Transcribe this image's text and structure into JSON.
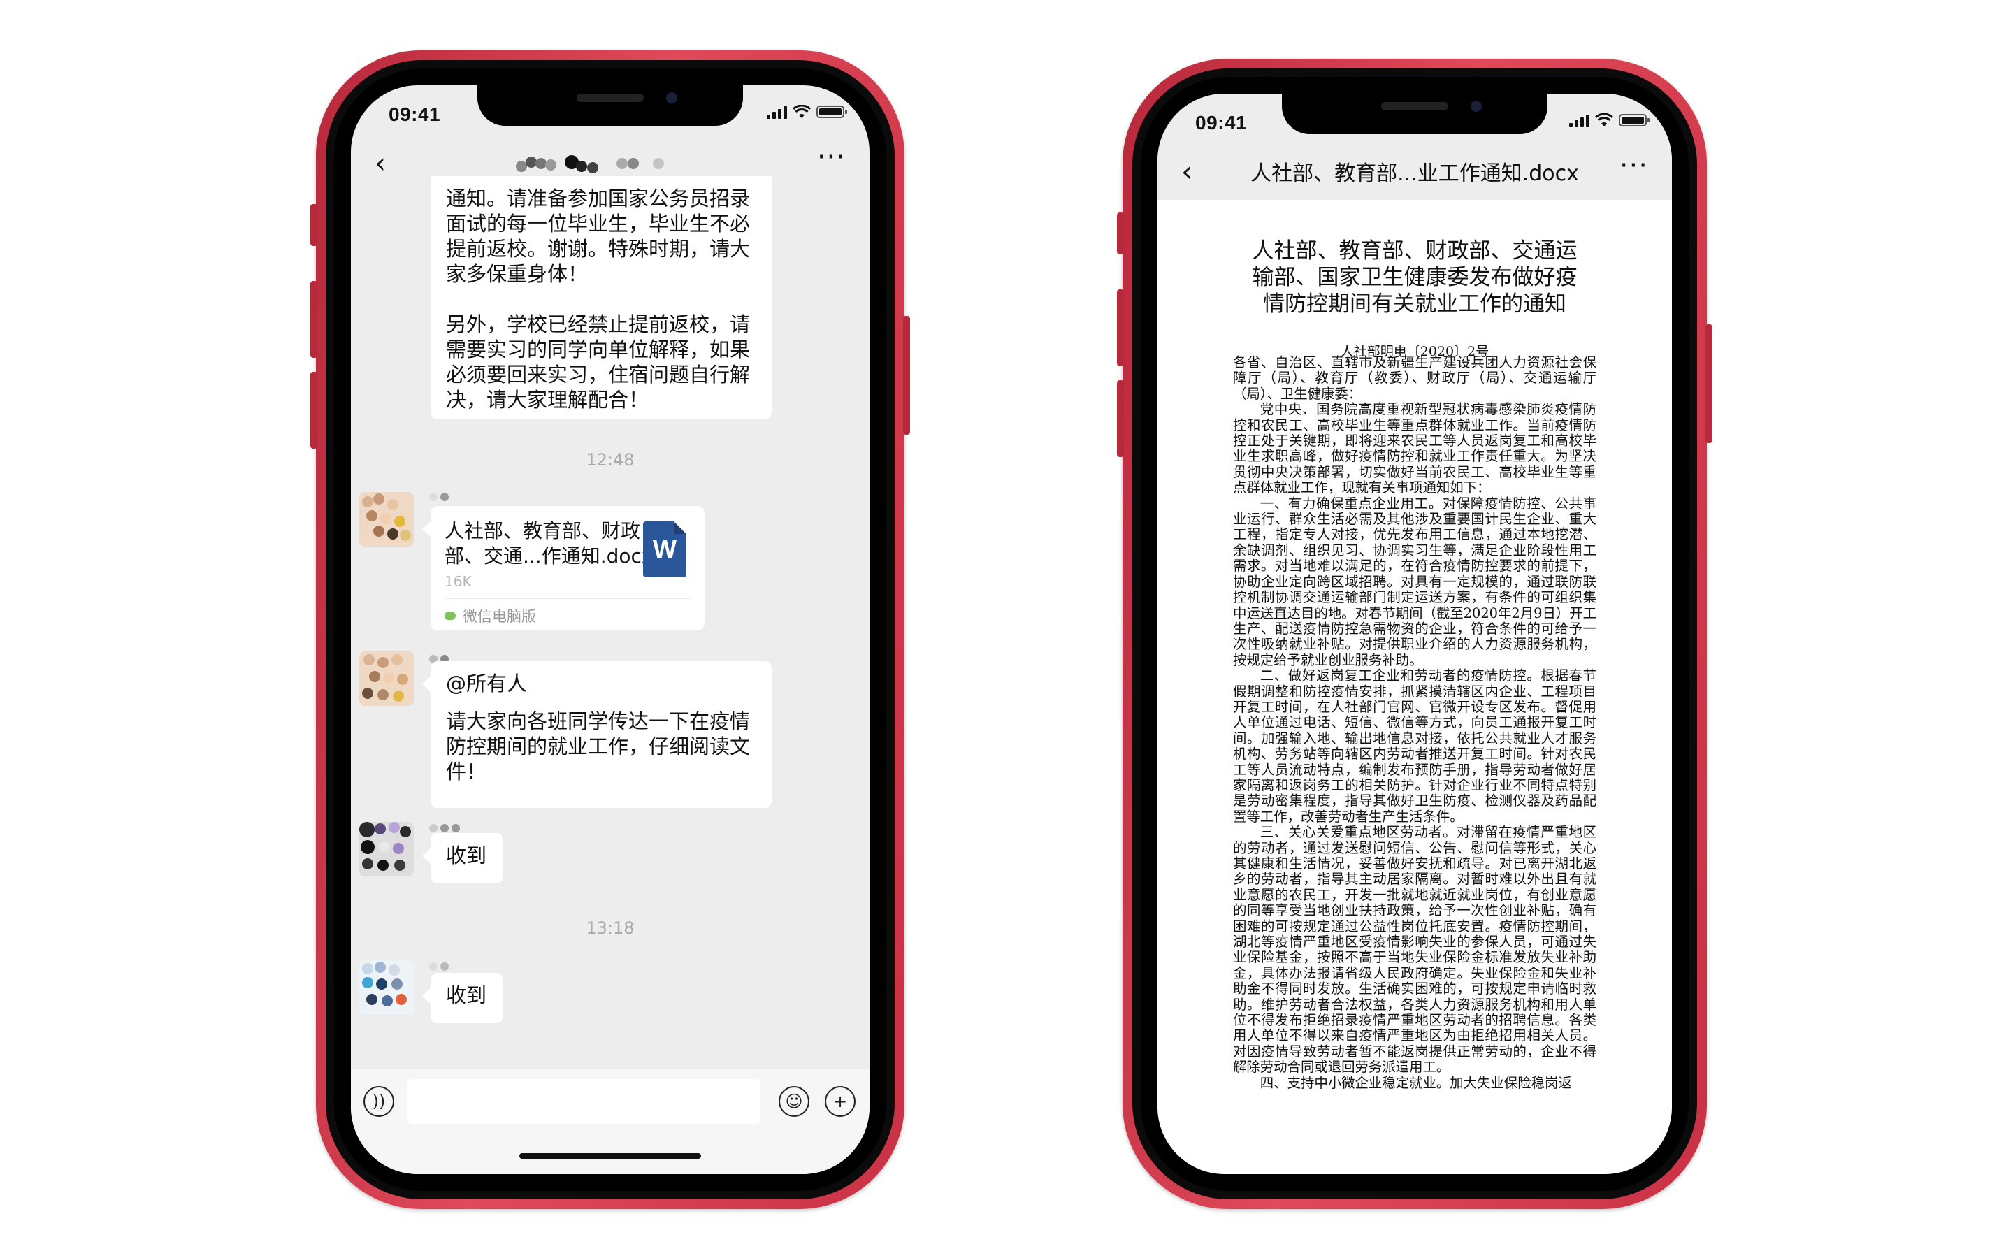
{
  "left_phone": {
    "status": {
      "time": "09:41"
    },
    "nav": {
      "back_icon": "‹",
      "more_icon": "···"
    },
    "messages": {
      "text1_lines": [
        "通知。请准备参加国家公务员招录",
        "面试的每一位毕业生，毕业生不必",
        "提前返校。谢谢。特殊时期，请大",
        "家多保重身体！"
      ],
      "text1_para2_lines": [
        "另外，学校已经禁止提前返校，请",
        "需要实习的同学向单位解释，如果",
        "必须要回来实习，住宿问题自行解",
        "决，请大家理解配合！"
      ],
      "time1": "12:48",
      "file_name_line1": "人社部、教育部、财政",
      "file_name_line2": "部、交通...作通知.docx",
      "file_size": "16K",
      "file_icon_letter": "W",
      "file_source": "微信电脑版",
      "mention": "@所有人",
      "text2_lines": [
        "请大家向各班同学传达一下在疫情",
        "防控期间的就业工作，仔细阅读文",
        "件！"
      ],
      "reply1": "收到",
      "time2": "13:18",
      "reply2": "收到"
    }
  },
  "right_phone": {
    "status": {
      "time": "09:41"
    },
    "nav": {
      "back_icon": "‹",
      "title": "人社部、教育部...业工作通知.docx",
      "more_icon": "···"
    },
    "doc": {
      "title_lines": [
        "人社部、教育部、财政部、交通运",
        "输部、国家卫生健康委发布做好疫",
        "情防控期间有关就业工作的通知"
      ],
      "doc_number": "人社部明电〔2020〕2号",
      "paragraphs": [
        "各省、自治区、直辖市及新疆生产建设兵团人力资源社会保障厅（局）、教育厅（教委）、财政厅（局）、交通运输厅（局）、卫生健康委：",
        "党中央、国务院高度重视新型冠状病毒感染肺炎疫情防控和农民工、高校毕业生等重点群体就业工作。当前疫情防控正处于关键期，即将迎来农民工等人员返岗复工和高校毕业生求职高峰，做好疫情防控和就业工作责任重大。为坚决贯彻中央决策部署，切实做好当前农民工、高校毕业生等重点群体就业工作，现就有关事项通知如下：",
        "一、有力确保重点企业用工。对保障疫情防控、公共事业运行、群众生活必需及其他涉及重要国计民生企业、重大工程，指定专人对接，优先发布用工信息，通过本地挖潜、余缺调剂、组织见习、协调实习生等，满足企业阶段性用工需求。对当地难以满足的，在符合疫情防控要求的前提下，协助企业定向跨区域招聘。对具有一定规模的，通过联防联控机制协调交通运输部门制定运送方案，有条件的可组织集中运送直达目的地。对春节期间（截至2020年2月9日）开工生产、配送疫情防控急需物资的企业，符合条件的可给予一次性吸纳就业补贴。对提供职业介绍的人力资源服务机构，按规定给予就业创业服务补助。",
        "二、做好返岗复工企业和劳动者的疫情防控。根据春节假期调整和防控疫情安排，抓紧摸清辖区内企业、工程项目开复工时间，在人社部门官网、官微开设专区发布。督促用人单位通过电话、短信、微信等方式，向员工通报开复工时间。加强输入地、输出地信息对接，依托公共就业人才服务机构、劳务站等向辖区内劳动者推送开复工时间。针对农民工等人员流动特点，编制发布预防手册，指导劳动者做好居家隔离和返岗务工的相关防护。针对企业行业不同特点特别是劳动密集程度，指导其做好卫生防疫、检测仪器及药品配置等工作，改善劳动者生产生活条件。",
        "三、关心关爱重点地区劳动者。对滞留在疫情严重地区的劳动者，通过发送慰问短信、公告、慰问信等形式，关心其健康和生活情况，妥善做好安抚和疏导。对已离开湖北返乡的劳动者，指导其主动居家隔离。对暂时难以外出且有就业意愿的农民工，开发一批就地就近就业岗位，有创业意愿的同等享受当地创业扶持政策，给予一次性创业补贴，确有困难的可按规定通过公益性岗位托底安置。疫情防控期间，湖北等疫情严重地区受疫情影响失业的参保人员，可通过失业保险基金，按照不高于当地失业保险金标准发放失业补助金，具体办法报请省级人民政府确定。失业保险金和失业补助金不得同时发放。生活确实困难的，可按规定申请临时救助。维护劳动者合法权益，各类人力资源服务机构和用人单位不得发布拒绝招录疫情严重地区劳动者的招聘信息。各类用人单位不得以来自疫情严重地区为由拒绝招用相关人员。对因疫情导致劳动者暂不能返岗提供正常劳动的，企业不得解除劳动合同或退回劳务派遣用工。",
        "四、支持中小微企业稳定就业。加大失业保险稳岗返"
      ]
    }
  },
  "colors": {
    "frame": "#d33b4c",
    "chat_bg": "#ededed",
    "word_blue": "#2b579a",
    "wechat_green": "#7cc15a"
  }
}
